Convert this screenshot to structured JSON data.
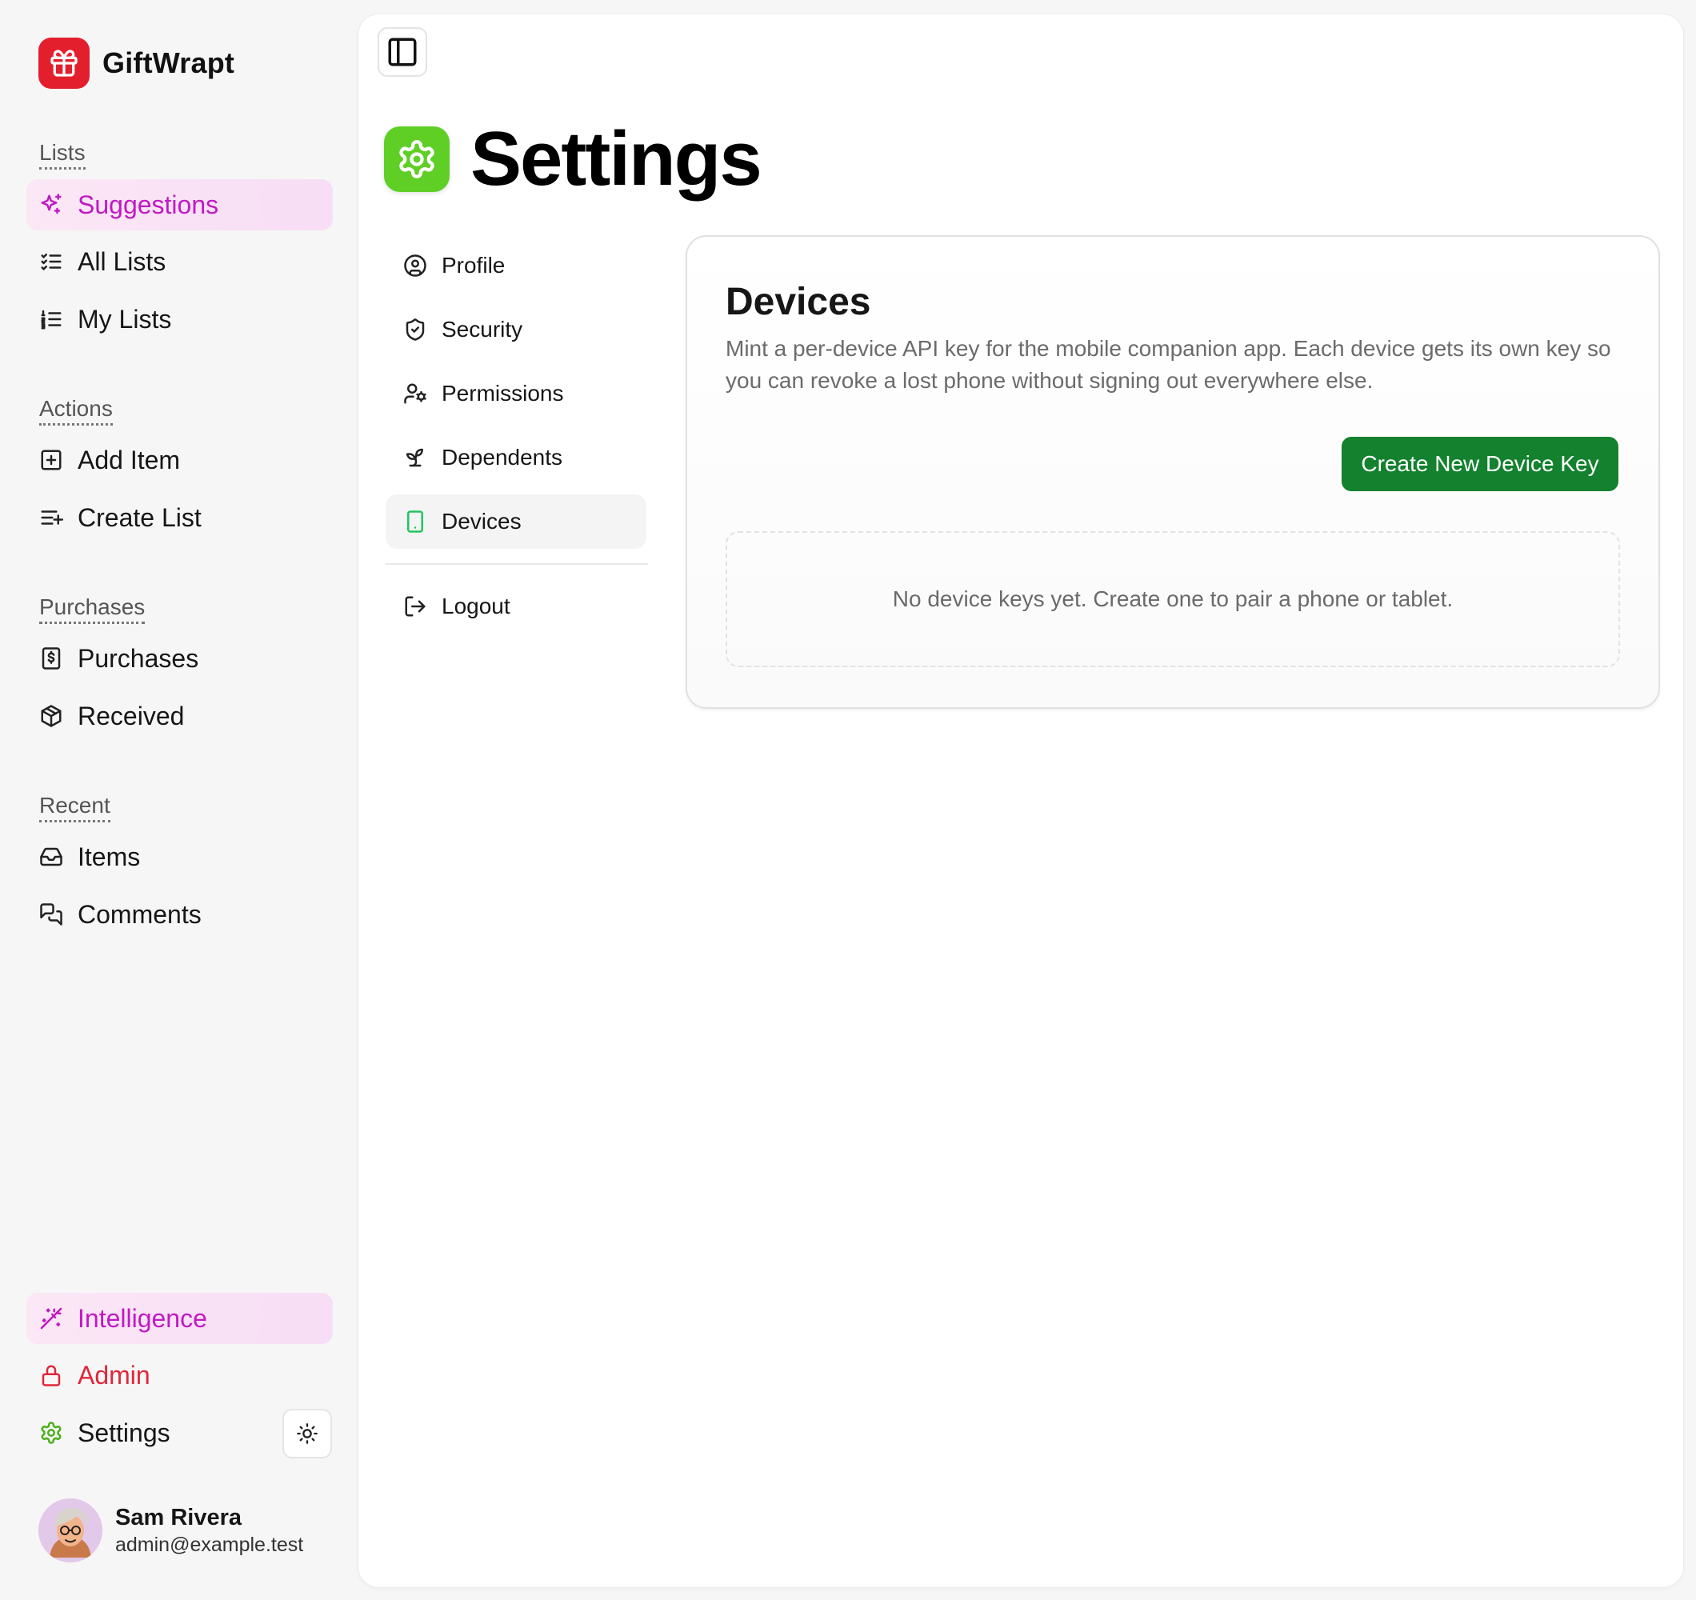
{
  "brand": {
    "name": "GiftWrapt"
  },
  "sidebar": {
    "sections": {
      "lists": "Lists",
      "actions": "Actions",
      "purchases": "Purchases",
      "recent": "Recent"
    },
    "items": {
      "suggestions": "Suggestions",
      "all_lists": "All Lists",
      "my_lists": "My Lists",
      "add_item": "Add Item",
      "create_list": "Create List",
      "purchases": "Purchases",
      "received": "Received",
      "items": "Items",
      "comments": "Comments"
    },
    "bottom": {
      "intelligence": "Intelligence",
      "admin": "Admin",
      "settings": "Settings"
    },
    "user": {
      "name": "Sam Rivera",
      "email": "admin@example.test"
    }
  },
  "page": {
    "title": "Settings"
  },
  "settings_nav": {
    "profile": "Profile",
    "security": "Security",
    "permissions": "Permissions",
    "dependents": "Dependents",
    "devices": "Devices",
    "logout": "Logout"
  },
  "devices_card": {
    "title": "Devices",
    "description": "Mint a per-device API key for the mobile companion app. Each device gets its own key so you can revoke a lost phone without signing out everywhere else.",
    "create_button": "Create New Device Key",
    "empty_message": "No device keys yet. Create one to pair a phone or tablet."
  },
  "colors": {
    "brand": "#e41f2d",
    "accent_pink": "#c01ac4",
    "admin_red": "#e0263a",
    "settings_green": "#5fcf25",
    "primary_button": "#13812e"
  }
}
